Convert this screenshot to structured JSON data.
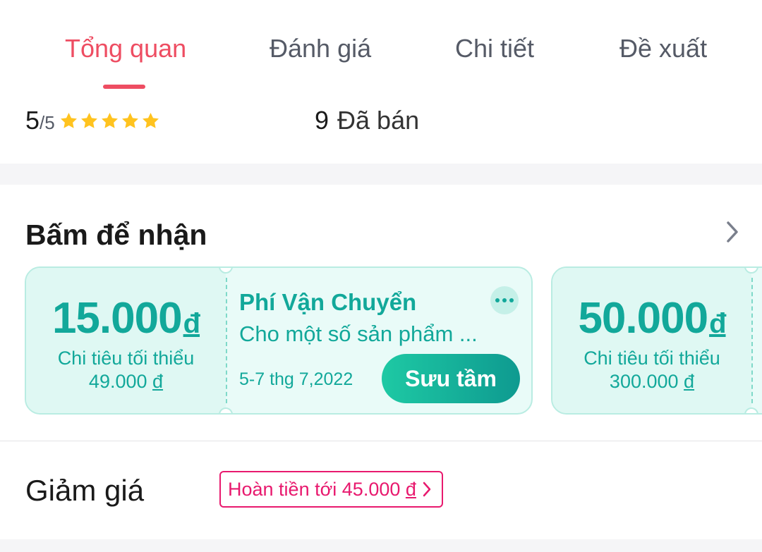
{
  "tabs": [
    {
      "label": "Tổng quan",
      "active": true
    },
    {
      "label": "Đánh giá",
      "active": false
    },
    {
      "label": "Chi tiết",
      "active": false
    },
    {
      "label": "Đề xuất",
      "active": false
    }
  ],
  "rating": {
    "value": "5",
    "max": "/5",
    "stars": 5
  },
  "sold": {
    "count": "9",
    "label": "Đã bán"
  },
  "claim_section": {
    "title": "Bấm để nhận"
  },
  "vouchers": [
    {
      "amount": "15.000",
      "currency": "đ",
      "min_label": "Chi tiêu tối thiểu",
      "min_value": "49.000",
      "min_currency": "đ",
      "title": "Phí Vận Chuyển",
      "description": "Cho một số sản phẩm ...",
      "date": "5-7 thg 7,2022",
      "button": "Sưu tầm"
    },
    {
      "amount": "50.000",
      "currency": "đ",
      "min_label": "Chi tiêu tối thiểu",
      "min_value": "300.000",
      "min_currency": "đ"
    }
  ],
  "discount": {
    "label": "Giảm giá",
    "tag_text": "Hoàn tiền tới 45.000",
    "tag_currency": "đ"
  },
  "colors": {
    "accent": "#ee4d62",
    "teal": "#12a89a",
    "pink": "#e8196e",
    "star": "#ffc31f"
  },
  "icons": {
    "star": "star-icon",
    "chevron": "chevron-right-icon",
    "more": "more-icon"
  }
}
